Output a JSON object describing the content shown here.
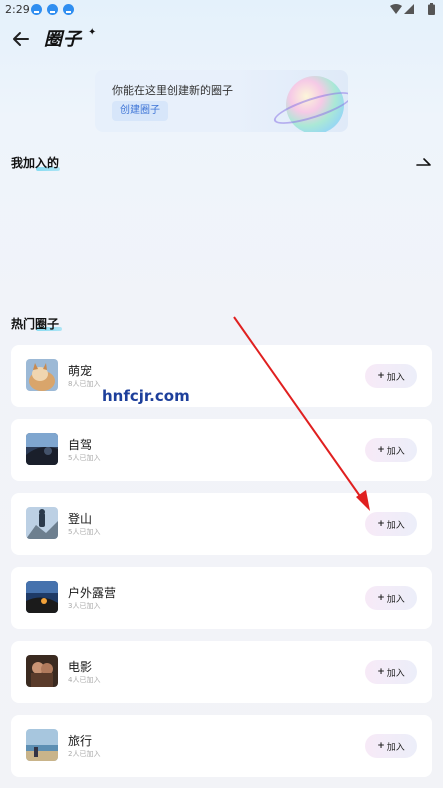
{
  "status_bar": {
    "time": "2:29",
    "download_icons": [
      "download-icon",
      "download-icon",
      "download-icon"
    ],
    "system_icons": [
      "wifi-icon",
      "signal-icon",
      "battery-icon"
    ]
  },
  "header": {
    "title": "圈子",
    "back_icon": "arrow-left-icon"
  },
  "banner": {
    "text": "你能在这里创建新的圈子",
    "create_button": "创建圈子"
  },
  "joined": {
    "title": "我加入的",
    "more_icon": "arrow-right-icon"
  },
  "hot": {
    "title": "热门圈子",
    "join_label": "加入",
    "items": [
      {
        "name": "萌宠",
        "count": "8人已加入",
        "thumb": "cat-photo"
      },
      {
        "name": "自驾",
        "count": "5人已加入",
        "thumb": "car-photo"
      },
      {
        "name": "登山",
        "count": "5人已加入",
        "thumb": "hiker-photo"
      },
      {
        "name": "户外露营",
        "count": "3人已加入",
        "thumb": "camp-photo"
      },
      {
        "name": "电影",
        "count": "4人已加入",
        "thumb": "movie-photo"
      },
      {
        "name": "旅行",
        "count": "2人已加入",
        "thumb": "travel-photo"
      }
    ]
  },
  "watermark": "hnfcjr.com",
  "colors": {
    "accent": "#3d74d6",
    "arrow": "#e02020",
    "watermark": "#1d3f9b"
  }
}
